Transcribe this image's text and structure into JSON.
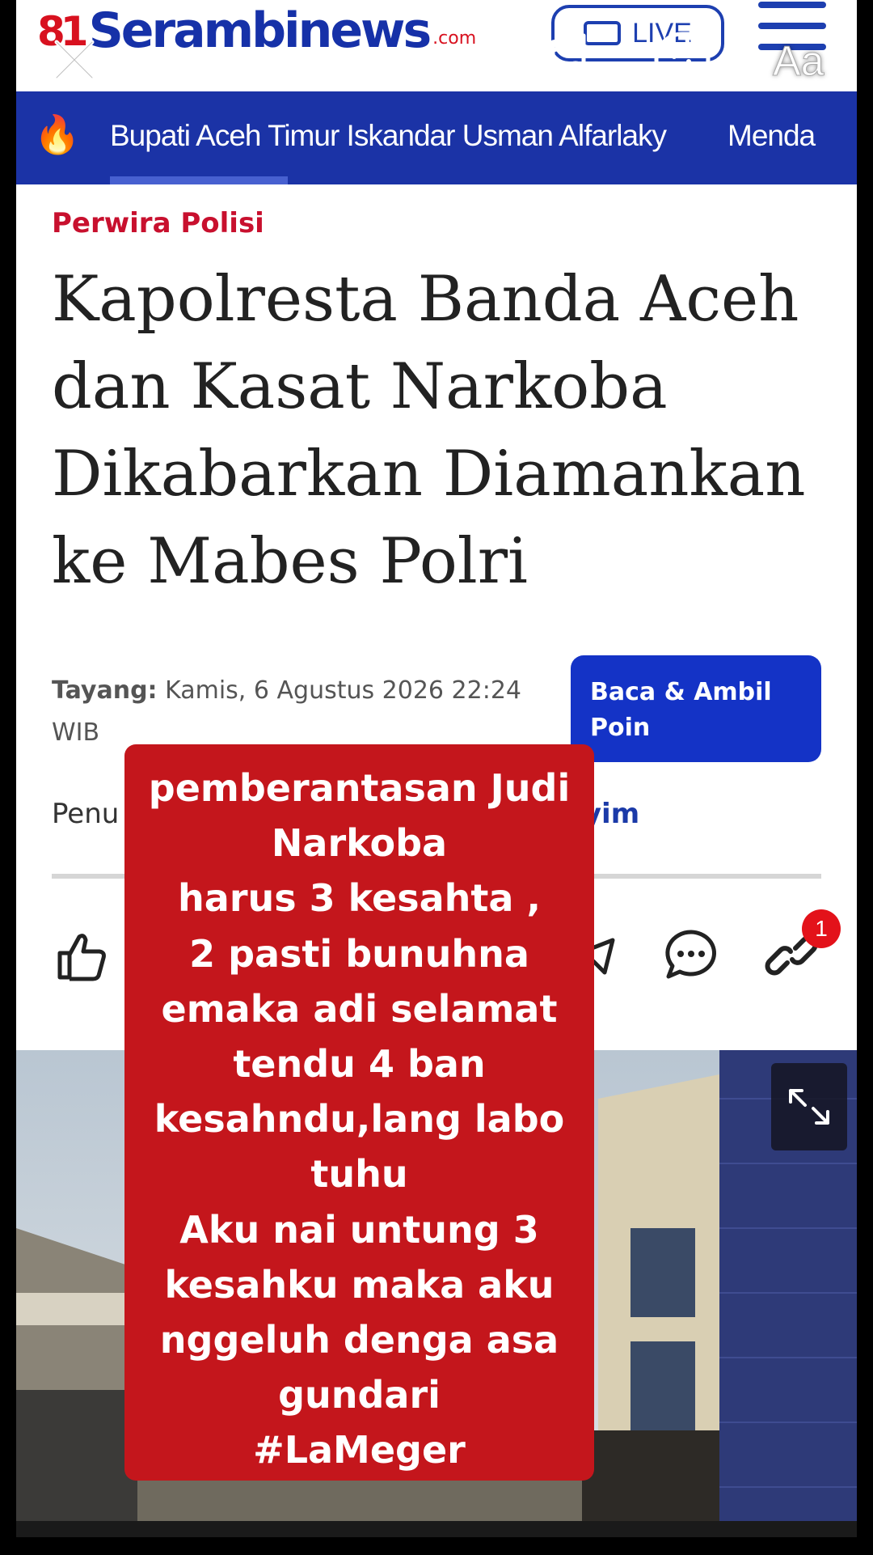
{
  "header": {
    "logo_mark": "81",
    "logo_word": "Serambinews",
    "logo_suffix": ".com",
    "live_label": "LIVE"
  },
  "trending": {
    "items": [
      "Bupati Aceh Timur Iskandar Usman Alfarlaky",
      "Menda"
    ]
  },
  "article": {
    "category": "Perwira Polisi",
    "title": "Kapolresta Banda Aceh dan Kasat Narkoba Dikabarkan Diamankan ke Mabes Polri",
    "published_label": "Tayang:",
    "published_value": "Kamis, 6 Agustus 2026 22:24 WIB",
    "read_button": "Baca & Ambil Poin",
    "author_prefix": "Penu",
    "author_name_visible": "ri Hasyim",
    "share_badge_count": "1"
  },
  "story_tools": {
    "text_tool_label": "Aa"
  },
  "caption": {
    "text": "pemberantasan Judi\nNarkoba\nharus 3 kesahta ,\n2 pasti bunuhna\nemaka adi selamat\ntendu 4 ban\nkesahndu,lang labo\ntuhu\nAku nai untung 3\nkesahku maka aku\nnggeluh denga asa\ngundari\n#LaMeger"
  },
  "colors": {
    "brand_blue": "#1b33a6",
    "brand_red": "#d8111f",
    "caption_red": "#c4161c"
  }
}
